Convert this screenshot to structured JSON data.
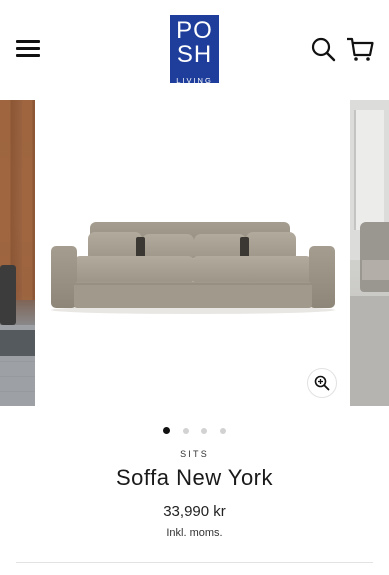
{
  "header": {
    "logo": {
      "line1": "PO",
      "line2": "SH",
      "line3": "LIVING"
    }
  },
  "gallery": {
    "slide_count": 4,
    "active_index": 0
  },
  "product": {
    "category": "SITS",
    "name": "Soffa New York",
    "price": "33,990 kr",
    "tax_note": "Inkl. moms."
  },
  "colors": {
    "brand": "#1f3e9b",
    "text": "#1a1a1a",
    "sofa_fabric": "#a89f90"
  },
  "icons": [
    "menu-icon",
    "search-icon",
    "cart-icon",
    "zoom-icon"
  ]
}
